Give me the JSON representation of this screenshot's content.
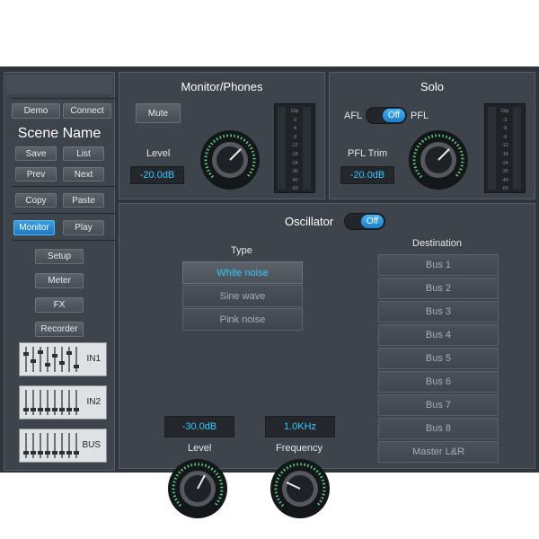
{
  "sidebar": {
    "demo": "Demo",
    "connect": "Connect",
    "scene_name": "Scene Name",
    "save": "Save",
    "list": "List",
    "prev": "Prev",
    "next": "Next",
    "copy": "Copy",
    "paste": "Paste",
    "monitor": "Monitor",
    "play": "Play",
    "setup": "Setup",
    "meter": "Meter",
    "fx": "FX",
    "recorder": "Recorder",
    "mixes": [
      {
        "label": "IN1"
      },
      {
        "label": "IN2"
      },
      {
        "label": "BUS"
      }
    ]
  },
  "monitor": {
    "title": "Monitor/Phones",
    "mute": "Mute",
    "level_label": "Level",
    "level_value": "-20.0dB",
    "meter_scale": [
      "Clip",
      "-3",
      "-6",
      "-9",
      "-12",
      "-18",
      "-24",
      "-30",
      "-40",
      "-60"
    ]
  },
  "solo": {
    "title": "Solo",
    "afl": "AFL",
    "pfl": "PFL",
    "toggle": "Off",
    "trim_label": "PFL Trim",
    "trim_value": "-20.0dB",
    "meter_scale": [
      "Clip",
      "-3",
      "-6",
      "-9",
      "-12",
      "-18",
      "-24",
      "-30",
      "-40",
      "-60"
    ]
  },
  "oscillator": {
    "title": "Oscillator",
    "toggle": "Off",
    "type_label": "Type",
    "types": [
      "White noise",
      "Sine wave",
      "Pink noise"
    ],
    "selected_type": "White noise",
    "level_value": "-30.0dB",
    "level_label": "Level",
    "freq_value": "1.0KHz",
    "freq_label": "Frequency",
    "destination_label": "Destination",
    "destinations": [
      "Bus 1",
      "Bus 2",
      "Bus 3",
      "Bus 4",
      "Bus 5",
      "Bus 6",
      "Bus 7",
      "Bus 8",
      "Master L&R"
    ]
  },
  "colors": {
    "accent": "#37c8ff",
    "active_button": "#1e78c4",
    "panel": "#3e444b",
    "background": "#30353b"
  }
}
